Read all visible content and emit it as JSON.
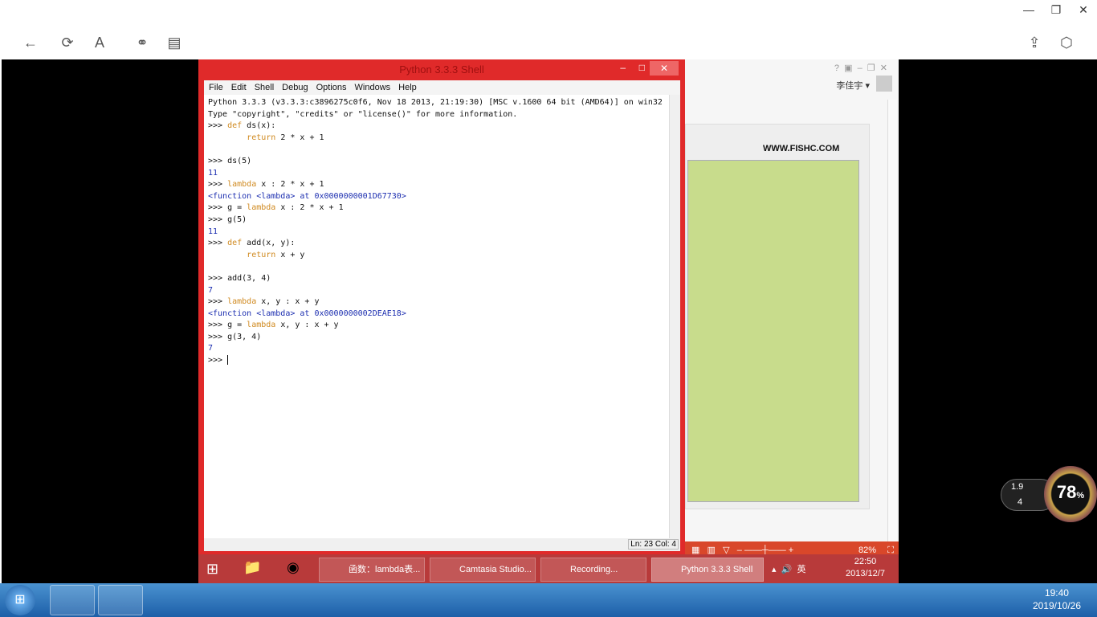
{
  "browser_toolbar": {
    "icons": [
      "back-icon",
      "refresh-icon",
      "font-icon",
      "link-icon",
      "window-icon",
      "share-icon",
      "cube-icon"
    ],
    "window_controls": [
      "—",
      "❐",
      "✕"
    ]
  },
  "shell": {
    "title": "Python 3.3.3 Shell",
    "menu": [
      "File",
      "Edit",
      "Shell",
      "Debug",
      "Options",
      "Windows",
      "Help"
    ],
    "lines": [
      [
        [
          "t",
          "Python 3.3.3 (v3.3.3:c3896275c0f6, Nov 18 2013, 21:19:30) [MSC v.1600 64 bit (AMD64)] on win32"
        ]
      ],
      [
        [
          "t",
          "Type \"copyright\", \"credits\" or \"license()\" for more information."
        ]
      ],
      [
        [
          "t",
          ">>> "
        ],
        [
          "kw",
          "def"
        ],
        [
          "t",
          " ds(x):"
        ]
      ],
      [
        [
          "t",
          "        "
        ],
        [
          "kw",
          "return"
        ],
        [
          "t",
          " 2 * x + 1"
        ]
      ],
      [
        [
          "t",
          ""
        ]
      ],
      [
        [
          "t",
          ">>> ds(5)"
        ]
      ],
      [
        [
          "out",
          "11"
        ]
      ],
      [
        [
          "t",
          ">>> "
        ],
        [
          "kw",
          "lambda"
        ],
        [
          "t",
          " x : 2 * x + 1"
        ]
      ],
      [
        [
          "out",
          "<function <lambda> at 0x0000000001D67730>"
        ]
      ],
      [
        [
          "t",
          ">>> g = "
        ],
        [
          "kw",
          "lambda"
        ],
        [
          "t",
          " x : 2 * x + 1"
        ]
      ],
      [
        [
          "t",
          ">>> g(5)"
        ]
      ],
      [
        [
          "out",
          "11"
        ]
      ],
      [
        [
          "t",
          ">>> "
        ],
        [
          "kw",
          "def"
        ],
        [
          "t",
          " add(x, y):"
        ]
      ],
      [
        [
          "t",
          "        "
        ],
        [
          "kw",
          "return"
        ],
        [
          "t",
          " x + y"
        ]
      ],
      [
        [
          "t",
          ""
        ]
      ],
      [
        [
          "t",
          ">>> add(3, 4)"
        ]
      ],
      [
        [
          "out",
          "7"
        ]
      ],
      [
        [
          "t",
          ">>> "
        ],
        [
          "kw",
          "lambda"
        ],
        [
          "t",
          " x, y : x + y"
        ]
      ],
      [
        [
          "out",
          "<function <lambda> at 0x0000000002DEAE18>"
        ]
      ],
      [
        [
          "t",
          ">>> g = "
        ],
        [
          "kw",
          "lambda"
        ],
        [
          "t",
          " x, y : x + y"
        ]
      ],
      [
        [
          "t",
          ">>> g(3, 4)"
        ]
      ],
      [
        [
          "out",
          "7"
        ]
      ],
      [
        [
          "t",
          ">>> "
        ]
      ]
    ],
    "status": "Ln: 23 Col: 4"
  },
  "ppt": {
    "user": "李佳宇 ▾",
    "site": "WWW.FISHC.COM",
    "zoom": "82%"
  },
  "win8_taskbar": {
    "items": [
      "函数：lambda表...",
      "Camtasia Studio...",
      "Recording...",
      "Python 3.3.3 Shell"
    ],
    "tray": "英",
    "time": "22:50",
    "date": "2013/12/7"
  },
  "overlay": {
    "cpu": "78",
    "cpu_unit": "%",
    "up": "1.9",
    "down": "4"
  },
  "win7_taskbar": {
    "time": "19:40",
    "date": "2019/10/26"
  }
}
